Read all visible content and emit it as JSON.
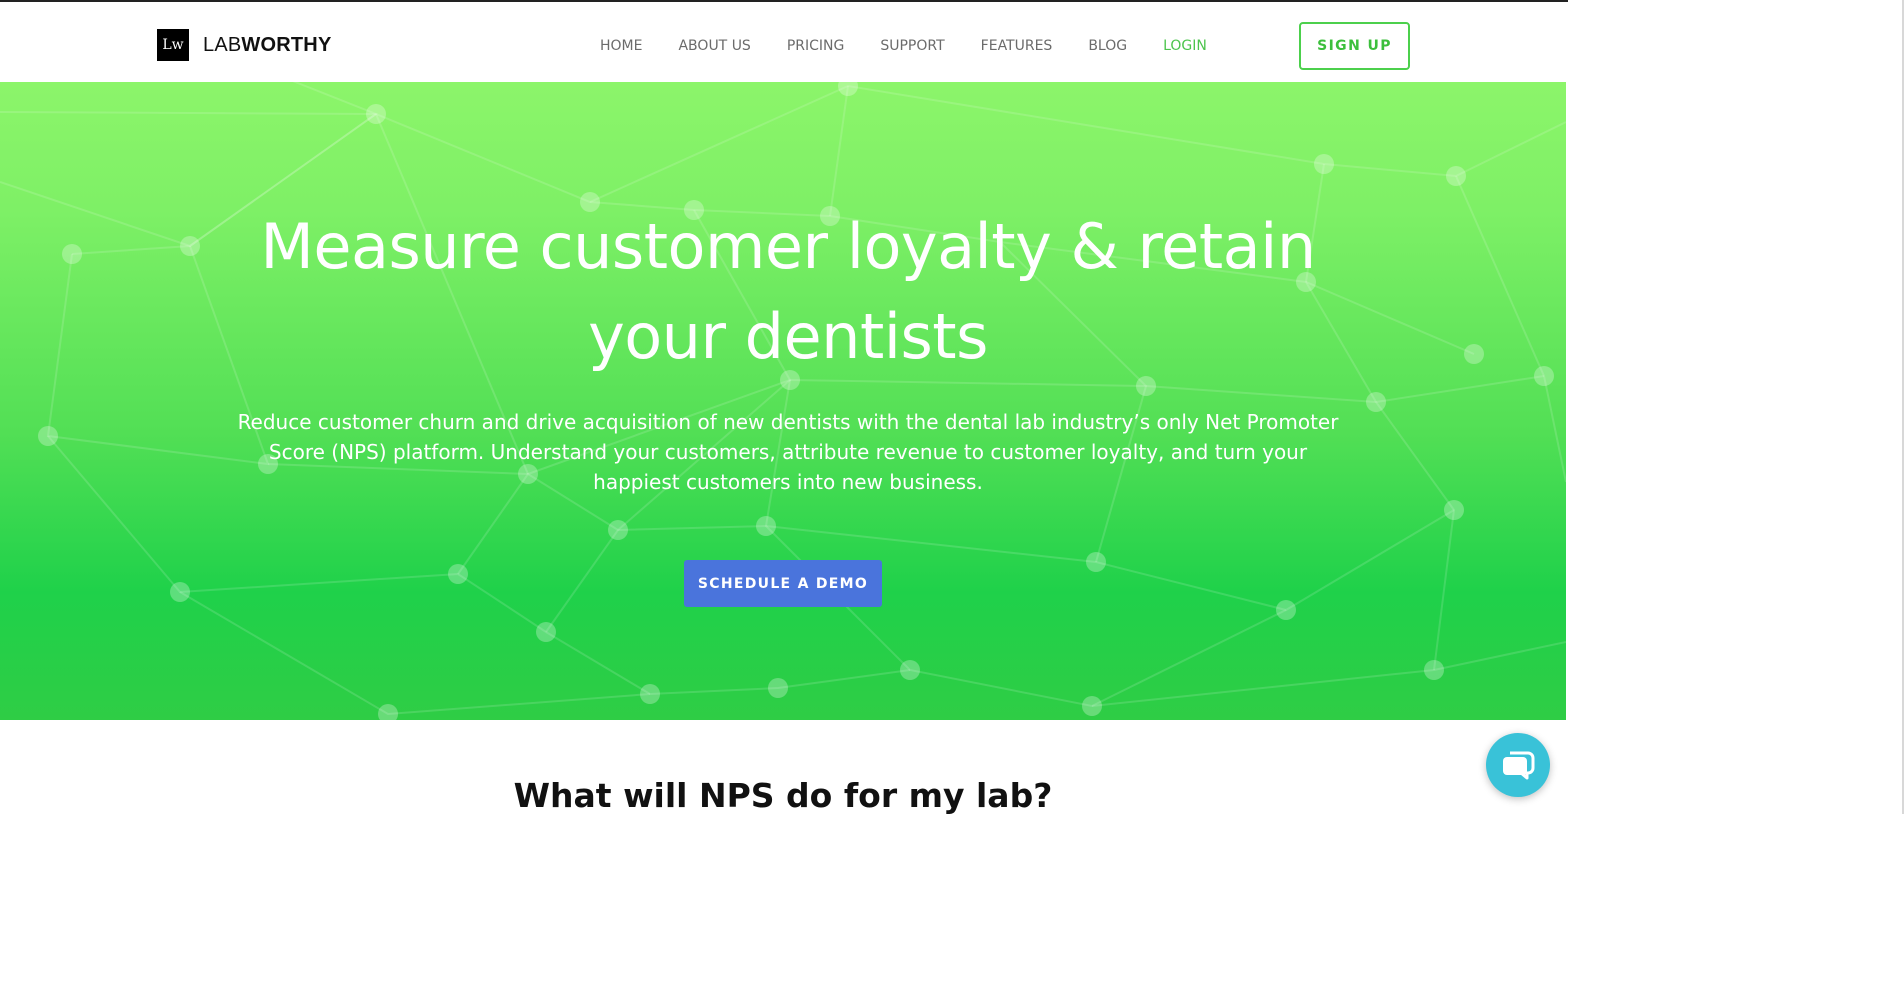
{
  "brand": {
    "logo_mark": "Lw",
    "name_light": "LAB",
    "name_bold": "WORTHY"
  },
  "nav": {
    "items": [
      {
        "label": "HOME"
      },
      {
        "label": "ABOUT US"
      },
      {
        "label": "PRICING"
      },
      {
        "label": "SUPPORT"
      },
      {
        "label": "FEATURES"
      },
      {
        "label": "BLOG"
      },
      {
        "label": "LOGIN"
      }
    ],
    "signup_label": "SIGN UP"
  },
  "hero": {
    "title_line1": "Measure customer loyalty & retain",
    "title_line2": "your dentists",
    "subtitle_line1": "Reduce customer churn and drive acquisition of new dentists with the dental lab industry’s only Net Promoter",
    "subtitle_line2": "Score (NPS) platform. Understand your customers, attribute revenue to customer loyalty, and turn your",
    "subtitle_line3": "happiest customers into new business.",
    "cta_label": "SCHEDULE A DEMO"
  },
  "section": {
    "title": "What will NPS do for my lab?"
  },
  "icons": {
    "chat": "chat-bubble-icon"
  },
  "colors": {
    "accent_green": "#4cc44c",
    "cta_blue": "#4a74dc",
    "chat_teal": "#39c2d8"
  }
}
